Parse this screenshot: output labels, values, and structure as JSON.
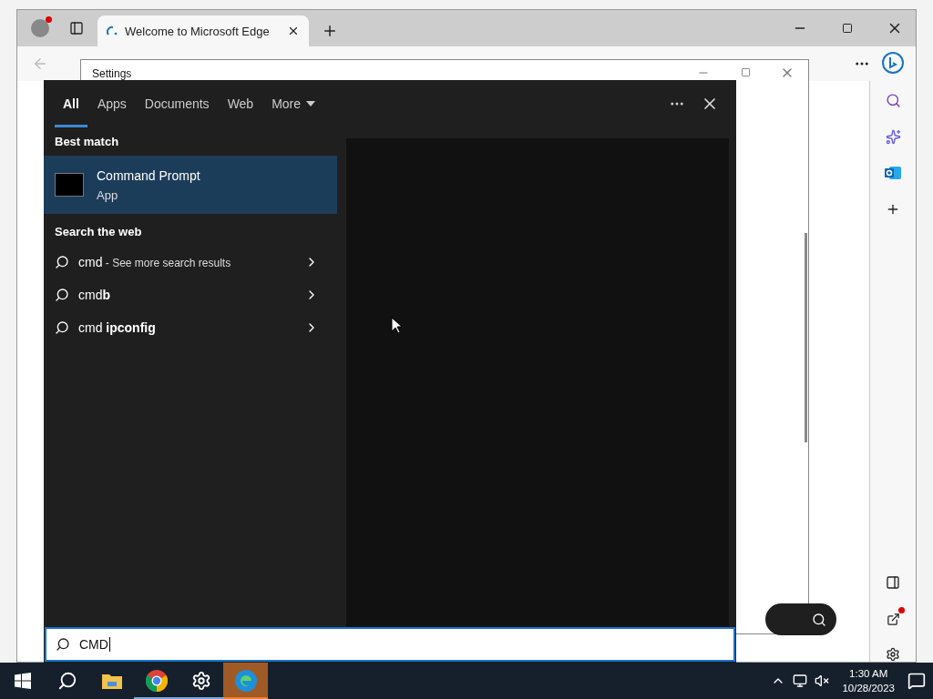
{
  "browser": {
    "tabs": [
      {
        "label": "Welcome to Microsoft Edge",
        "selected": true
      }
    ]
  },
  "settings_window": {
    "title": "Settings"
  },
  "search_panel": {
    "tabs": [
      {
        "label": "All",
        "selected": true,
        "kind": "tab"
      },
      {
        "label": "Apps",
        "selected": false,
        "kind": "tab"
      },
      {
        "label": "Documents",
        "selected": false,
        "kind": "tab"
      },
      {
        "label": "Web",
        "selected": false,
        "kind": "tab"
      },
      {
        "label": "More",
        "selected": false,
        "kind": "dropdown"
      }
    ],
    "best_match_heading": "Best match",
    "best_match": {
      "name": "Command Prompt",
      "type": "App",
      "selected": true
    },
    "web_heading": "Search the web",
    "web_results": [
      {
        "query": "cmd",
        "suffix": "- See more search results"
      },
      {
        "query": "cmd**b**"
      },
      {
        "query": "cmd **ipconfig**"
      }
    ]
  },
  "search_box": {
    "value": "CMD"
  },
  "taskbar": {
    "apps": [
      {
        "kind": "explorer",
        "running": false,
        "active": false
      },
      {
        "kind": "chrome",
        "running": true,
        "active": false
      },
      {
        "kind": "settings",
        "running": true,
        "active": false
      },
      {
        "kind": "edge",
        "running": true,
        "active": true
      }
    ],
    "clock": {
      "time": "1:30 AM",
      "date": "10/28/2023"
    }
  }
}
